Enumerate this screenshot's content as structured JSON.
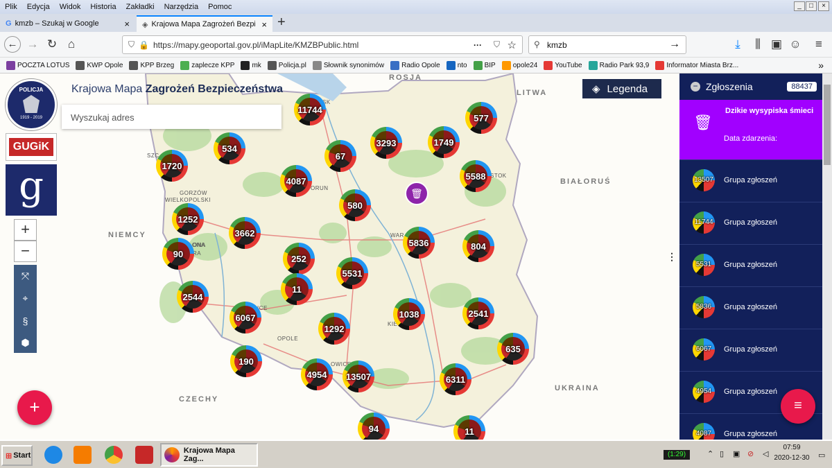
{
  "browser": {
    "menu": [
      "Plik",
      "Edycja",
      "Widok",
      "Historia",
      "Zakładki",
      "Narzędzia",
      "Pomoc"
    ],
    "tabs": [
      {
        "label": "kmzb – Szukaj w Google"
      },
      {
        "label": "Krajowa Mapa Zagrożeń Bezpieczeń"
      }
    ],
    "url": "https://mapy.geoportal.gov.pl/iMapLite/KMZBPublic.html",
    "search_value": "kmzb",
    "bookmarks": [
      "POCZTA LOTUS",
      "KWP Opole",
      "KPP Brzeg",
      "zaplecze KPP",
      "mk",
      "Policja.pl",
      "Słownik synonimów",
      "Radio Opole",
      "nto",
      "BIP",
      "opole24",
      "YouTube",
      "Radio Park 93,9",
      "Informator Miasta Brz..."
    ],
    "bookmark_colors": [
      "#7b3fa0",
      "#555",
      "#555",
      "#4caf50",
      "#222",
      "#555",
      "#888",
      "#3a6fc4",
      "#1565c0",
      "#43a047",
      "#ff9800",
      "#e53935",
      "#26a69a",
      "#e53935"
    ]
  },
  "map": {
    "title_prefix": "Krajowa Mapa ",
    "title_bold": "Zagrożeń Bezpieczeństwa",
    "search_placeholder": "Wyszukaj adres",
    "legend_label": "Legenda",
    "countries": [
      "ROSJA",
      "LITWA",
      "BIAŁORUŚ",
      "NIEMCY",
      "CZECHY",
      "UKRAINA"
    ],
    "cities": [
      "GORZÓW",
      "WIELKOPOLSKI",
      "ORUN",
      "OPOLE",
      "WAR",
      "STOK",
      "SZC",
      "ONA",
      "ZIELONA",
      "RA",
      "ICE",
      "KIE",
      "OWICE",
      "SK"
    ],
    "clusters": [
      "11744",
      "577",
      "534",
      "3293",
      "1749",
      "1720",
      "67",
      "4087",
      "5588",
      "580",
      "1252",
      "3662",
      "5836",
      "804",
      "90",
      "252",
      "5531",
      "11",
      "2544",
      "6067",
      "1038",
      "2541",
      "1292",
      "635",
      "190",
      "4954",
      "13507",
      "6311",
      "94",
      "11"
    ],
    "special_icon": "garbage-icon",
    "fab_add": "+",
    "logos": {
      "gugik": "GUGiK",
      "police_top": "POLICJA",
      "police_years": "1919 - 2019"
    }
  },
  "panel": {
    "title": "Zgłoszenia",
    "count": "88437",
    "featured": {
      "title": "Dzikie wysypiska śmieci",
      "date_label": "Data zdarzenia:"
    },
    "items": [
      {
        "value": "13507",
        "label": "Grupa zgłoszeń"
      },
      {
        "value": "11744",
        "label": "Grupa zgłoszeń"
      },
      {
        "value": "5531",
        "label": "Grupa zgłoszeń"
      },
      {
        "value": "5836",
        "label": "Grupa zgłoszeń"
      },
      {
        "value": "6067",
        "label": "Grupa zgłoszeń"
      },
      {
        "value": "4954",
        "label": "Grupa zgłoszeń"
      },
      {
        "value": "4087",
        "label": "Grupa zgłoszeń"
      }
    ]
  },
  "taskbar": {
    "start": "Start",
    "active_window": "Krajowa Mapa Zag...",
    "battery": "(1:29)",
    "time": "07:59",
    "date": "2020-12-30"
  }
}
